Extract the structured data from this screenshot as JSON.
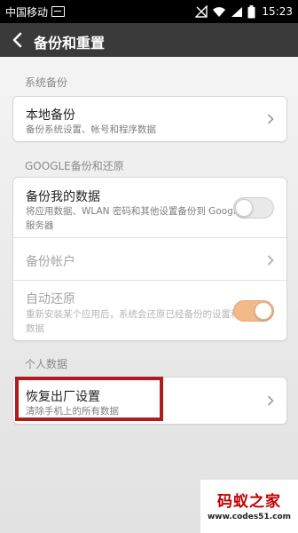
{
  "status_bar": {
    "carrier": "中国移动",
    "time": "15:23",
    "icons": [
      "message-icon",
      "no-signal-icon",
      "wifi-icon",
      "signal-icon",
      "battery-icon"
    ]
  },
  "action_bar": {
    "back_icon": "chevron-left-icon",
    "title": "备份和重置"
  },
  "sections": {
    "system_backup": {
      "header": "系统备份",
      "local_backup": {
        "title": "本地备份",
        "subtitle": "备份系统设置、帐号和程序数据"
      }
    },
    "google": {
      "header": "GOOGLE备份和还原",
      "backup_my_data": {
        "title": "备份我的数据",
        "subtitle": "将应用数据、WLAN 密码和其他设置备份到 Google 服务器",
        "toggle_on": false
      },
      "backup_account": {
        "title": "备份帐户"
      },
      "auto_restore": {
        "title": "自动还原",
        "subtitle": "重新安装某个应用后，系统会还原已经备份的设置和数据",
        "toggle_on": true
      }
    },
    "personal": {
      "header": "个人数据",
      "factory_reset": {
        "title": "恢复出厂设置",
        "subtitle": "清除手机上的所有数据"
      }
    }
  },
  "colors": {
    "highlight": "#b01c1c",
    "toggle_on": "#f2b98a",
    "action_bar": "#3a3a3a"
  },
  "watermark": {
    "title": "码蚁之家",
    "url": "www.codes51.com"
  }
}
